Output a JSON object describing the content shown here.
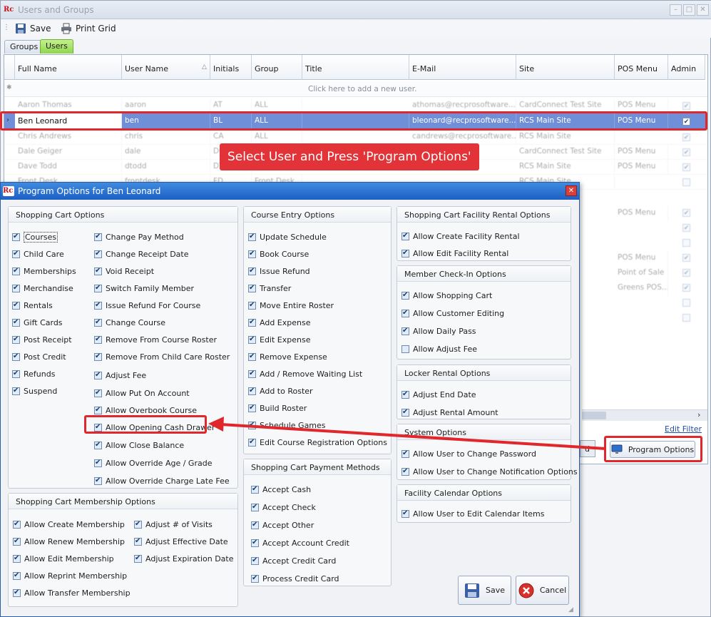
{
  "window": {
    "title": "Users and Groups"
  },
  "toolbar": {
    "save": "Save",
    "print": "Print Grid"
  },
  "tabs": [
    "Groups",
    "Users"
  ],
  "grid": {
    "columns": [
      "Full Name",
      "User Name",
      "Initials",
      "Group",
      "Title",
      "E-Mail",
      "Site",
      "POS Menu",
      "Admin"
    ],
    "new_row": "Click here to add a new user.",
    "rows": [
      {
        "name": "Aaron Thomas",
        "user": "aaron",
        "init": "AT",
        "group": "ALL",
        "title": "",
        "email": "athomas@recprosoftware...",
        "site": "CardConnect Test Site",
        "pos": "POS Menu",
        "admin": true
      },
      {
        "name": "Ben Leonard",
        "user": "ben",
        "init": "BL",
        "group": "ALL",
        "title": "",
        "email": "bleonard@recprosoftware....",
        "site": "RCS Main Site",
        "pos": "POS Menu",
        "admin": true
      },
      {
        "name": "Chris Andrews",
        "user": "chris",
        "init": "CA",
        "group": "ALL",
        "title": "",
        "email": "candrews@recprosoftware...",
        "site": "RCS Main Site",
        "pos": "",
        "admin": true
      },
      {
        "name": "Dale Geiger",
        "user": "dale",
        "init": "DG",
        "group": "",
        "title": "",
        "email": "",
        "site": "CardConnect Test Site",
        "pos": "POS Menu",
        "admin": true
      },
      {
        "name": "Dave Todd",
        "user": "dtodd",
        "init": "DT",
        "group": "",
        "title": "",
        "email": "",
        "site": "RCS Main Site",
        "pos": "POS Menu",
        "admin": true
      },
      {
        "name": "Front Desk",
        "user": "frontdesk",
        "init": "FD",
        "group": "Front Desk",
        "title": "",
        "email": "",
        "site": "RCS Main Site",
        "pos": "",
        "admin": false
      }
    ],
    "extra_pos": [
      "POS Menu",
      "",
      "",
      "POS Menu",
      "Point of Sale",
      "Greens POS..."
    ],
    "edit_filter": "Edit Filter"
  },
  "callout": "Select User and Press 'Program Options'",
  "program_options_button": "Program Options",
  "dialog": {
    "title": "Program Options for Ben Leonard",
    "groups": {
      "cart": {
        "title": "Shopping Cart Options",
        "col1": [
          [
            "Courses",
            true
          ],
          [
            "Child Care",
            true
          ],
          [
            "Memberships",
            true
          ],
          [
            "Merchandise",
            true
          ],
          [
            "Rentals",
            true
          ],
          [
            "Gift Cards",
            true
          ],
          [
            "Post Receipt",
            true
          ],
          [
            "Post Credit",
            true
          ],
          [
            "Refunds",
            true
          ],
          [
            "Suspend",
            true
          ]
        ],
        "col2": [
          [
            "Change Pay Method",
            true
          ],
          [
            "Change Receipt Date",
            true
          ],
          [
            "Void Receipt",
            true
          ],
          [
            "Switch Family Member",
            true
          ],
          [
            "Issue Refund For Course",
            true
          ],
          [
            "Change Course",
            true
          ],
          [
            "Remove From Course Roster",
            true
          ],
          [
            "Remove From Child Care Roster",
            true
          ],
          [
            "Adjust Fee",
            true
          ],
          [
            "Allow Put On Account",
            true
          ],
          [
            "Allow Overbook Course",
            true
          ],
          [
            "Allow Opening Cash Drawer",
            true
          ],
          [
            "Allow Close Balance",
            true
          ],
          [
            "Allow Override Age / Grade",
            true
          ],
          [
            "Allow Override Charge Late Fee",
            true
          ]
        ]
      },
      "membership": {
        "title": "Shopping Cart Membership Options",
        "col1": [
          [
            "Allow Create Membership",
            true
          ],
          [
            "Allow Renew Membership",
            true
          ],
          [
            "Allow Edit Membership",
            true
          ],
          [
            "Allow Reprint Membership",
            true
          ],
          [
            "Allow Transfer Membership",
            true
          ]
        ],
        "col2": [
          [
            "Adjust # of Visits",
            true
          ],
          [
            "Adjust Effective Date",
            true
          ],
          [
            "Adjust Expiration Date",
            true
          ]
        ]
      },
      "course": {
        "title": "Course Entry Options",
        "items": [
          [
            "Update Schedule",
            true
          ],
          [
            "Book Course",
            true
          ],
          [
            "Issue Refund",
            true
          ],
          [
            "Transfer",
            true
          ],
          [
            "Move Entire Roster",
            true
          ],
          [
            "Add Expense",
            true
          ],
          [
            "Edit Expense",
            true
          ],
          [
            "Remove Expense",
            true
          ],
          [
            "Add / Remove Waiting List",
            true
          ],
          [
            "Add to Roster",
            true
          ],
          [
            "Build Roster",
            true
          ],
          [
            "Schedule Games",
            true
          ],
          [
            "Edit Course Registration Options",
            true
          ]
        ]
      },
      "payment": {
        "title": "Shopping Cart Payment Methods",
        "items": [
          [
            "Accept Cash",
            true
          ],
          [
            "Accept Check",
            true
          ],
          [
            "Accept Other",
            true
          ],
          [
            "Accept Account Credit",
            true
          ],
          [
            "Accept Credit Card",
            true
          ],
          [
            "Process Credit Card",
            true
          ]
        ]
      },
      "facility": {
        "title": "Shopping Cart Facility Rental Options",
        "items": [
          [
            "Allow Create Facility Rental",
            true
          ],
          [
            "Allow Edit Facility Rental",
            true
          ]
        ]
      },
      "checkin": {
        "title": "Member Check-In Options",
        "items": [
          [
            "Allow Shopping Cart",
            true
          ],
          [
            "Allow Customer Editing",
            true
          ],
          [
            "Allow Daily Pass",
            true
          ],
          [
            "Allow Adjust Fee",
            false
          ]
        ]
      },
      "locker": {
        "title": "Locker Rental Options",
        "items": [
          [
            "Adjust End Date",
            true
          ],
          [
            "Adjust Rental Amount",
            true
          ]
        ]
      },
      "system": {
        "title": "System Options",
        "items": [
          [
            "Allow User to Change Password",
            true
          ],
          [
            "Allow User to Change Notification Options",
            true
          ]
        ]
      },
      "calendar": {
        "title": "Facility Calendar Options",
        "items": [
          [
            "Allow User to Edit Calendar Items",
            true
          ]
        ]
      }
    },
    "save": "Save",
    "cancel": "Cancel"
  }
}
